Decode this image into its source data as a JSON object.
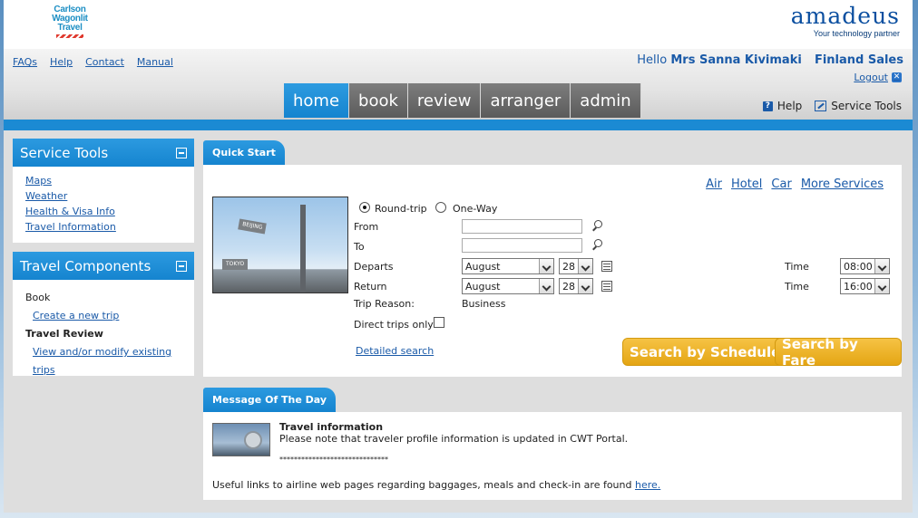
{
  "header": {
    "cwt_logo": [
      "Carlson",
      "Wagonlit",
      "Travel"
    ],
    "amadeus_word": "amadeus",
    "amadeus_tagline": "Your technology partner",
    "top_links": [
      "FAQs",
      "Help",
      "Contact",
      "Manual"
    ],
    "hello_prefix": "Hello",
    "user_name": "Mrs Sanna Kivimaki",
    "org": "Finland Sales",
    "logout": "Logout",
    "nav_tabs": [
      "home",
      "book",
      "review",
      "arranger",
      "admin"
    ],
    "help_label": "Help",
    "service_tools_label": "Service Tools"
  },
  "sidebar": {
    "service_tools": {
      "title": "Service Tools",
      "links": [
        "Maps",
        "Weather",
        "Health & Visa Info",
        "Travel Information"
      ]
    },
    "travel_components": {
      "title": "Travel Components",
      "book_label": "Book",
      "create_trip": "Create a new trip",
      "review_label": "Travel Review",
      "modify_trips": "View and/or modify existing trips"
    }
  },
  "quick_start": {
    "tab": "Quick Start",
    "service_links": [
      "Air",
      "Hotel",
      "Car",
      "More Services"
    ],
    "photo_signs": [
      "BEIJING",
      "TOKYO"
    ],
    "round_trip": "Round-trip",
    "one_way": "One-Way",
    "from_label": "From",
    "to_label": "To",
    "departs_label": "Departs",
    "return_label": "Return",
    "departs_month": "August",
    "departs_day": "28",
    "return_month": "August",
    "return_day": "28",
    "time_label": "Time",
    "departs_time": "08:00",
    "return_time": "16:00",
    "trip_reason_label": "Trip Reason:",
    "trip_reason_value": "Business",
    "direct_trips": "Direct trips only",
    "detailed_search": "Detailed search",
    "search_schedule": "Search by Schedule",
    "search_fare": "Search by Fare"
  },
  "motd": {
    "tab": "Message Of The Day",
    "title": "Travel information",
    "body": "Please note that traveler profile information is updated in CWT Portal.",
    "stars": "******************************",
    "useful_prefix": "Useful links to airline web pages regarding baggages, meals and check-in are found ",
    "here": "here."
  }
}
